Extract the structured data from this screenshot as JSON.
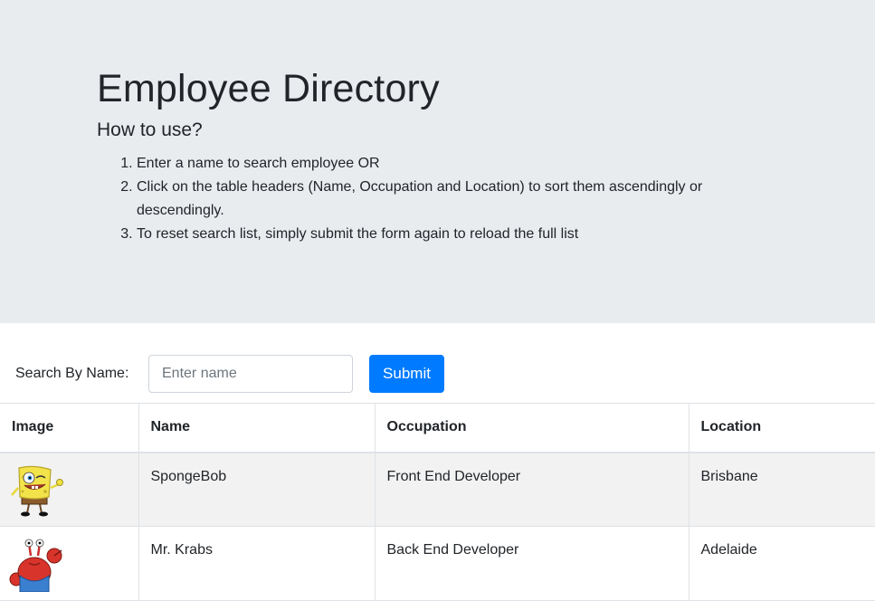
{
  "header": {
    "title": "Employee Directory",
    "subtitle": "How to use?",
    "instructions": [
      "Enter a name to search employee OR",
      "Click on the table headers (Name, Occupation and Location) to sort them ascendingly or descendingly.",
      "To reset search list, simply submit the form again to reload the full list"
    ]
  },
  "search": {
    "label": "Search By Name:",
    "placeholder": "Enter name",
    "value": "",
    "submit_label": "Submit"
  },
  "table": {
    "headers": [
      "Image",
      "Name",
      "Occupation",
      "Location"
    ],
    "rows": [
      {
        "image_icon": "spongebob-avatar",
        "name": "SpongeBob",
        "occupation": "Front End Developer",
        "location": "Brisbane"
      },
      {
        "image_icon": "mr-krabs-avatar",
        "name": "Mr. Krabs",
        "occupation": "Back End Developer",
        "location": "Adelaide"
      }
    ]
  },
  "colors": {
    "jumbotron_bg": "#e9ecef",
    "primary": "#007bff",
    "striped_row": "#f2f2f2"
  }
}
